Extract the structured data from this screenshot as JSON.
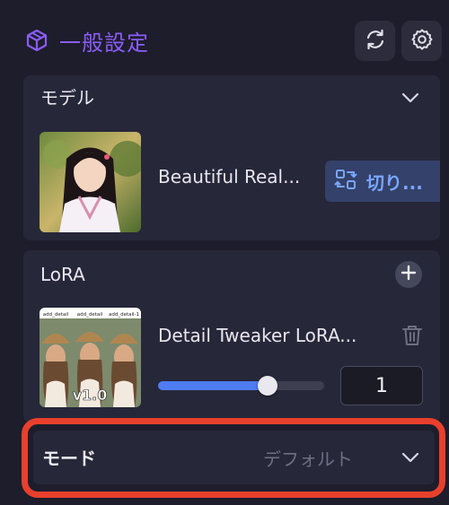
{
  "header": {
    "title": "一般設定",
    "title_icon": "cube-icon",
    "refresh_icon": "refresh-icon",
    "settings_icon": "gear-icon",
    "accent_color": "#8b5cf6"
  },
  "model_section": {
    "title": "モデル",
    "model_name": "Beautiful Real...",
    "switch_label": "切り...",
    "switch_icon": "swap-icon"
  },
  "lora_section": {
    "title": "LoRA",
    "lora_name": "Detail Tweaker LoRA...",
    "thumb_badge": "v1.0",
    "thumb_captions": [
      "add_detail",
      "add_detail",
      "add_detail-1"
    ],
    "weight_value": "1",
    "slider_fraction": 0.66
  },
  "mode_section": {
    "label": "モード",
    "value": "デフォルト",
    "highlight_color": "#e8402c"
  }
}
